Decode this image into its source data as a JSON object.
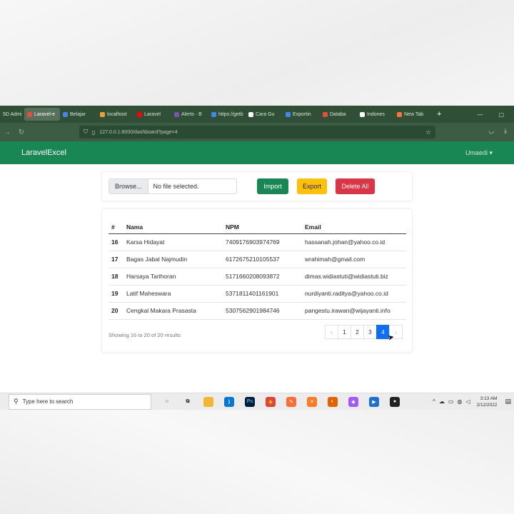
{
  "browser": {
    "tabs": [
      {
        "label": "5D Admi",
        "color": "#3a6ea5",
        "active": false
      },
      {
        "label": "Laravel-e",
        "color": "#e74c3c",
        "active": true
      },
      {
        "label": "Belajar",
        "color": "#4285f4",
        "active": false
      },
      {
        "label": "localhost",
        "color": "#f0a030",
        "active": false
      },
      {
        "label": "Laravel",
        "color": "#ff0000",
        "active": false
      },
      {
        "label": "Alerts · B",
        "color": "#7952b3",
        "active": false
      },
      {
        "label": "https://getb",
        "color": "#4285f4",
        "active": false
      },
      {
        "label": "Cara Gu",
        "color": "#ffffff",
        "active": false
      },
      {
        "label": "Exportin",
        "color": "#4285f4",
        "active": false
      },
      {
        "label": "Databa",
        "color": "#e74c3c",
        "active": false
      },
      {
        "label": "Indones",
        "color": "#ffffff",
        "active": false
      },
      {
        "label": "New Tab",
        "color": "#ff7139",
        "active": false
      }
    ],
    "url": "127.0.0.1:8000/dashboard?page=4"
  },
  "app": {
    "brand": "LaravelExcel",
    "user": "Umaedi"
  },
  "upload": {
    "browse_label": "Browse...",
    "file_status": "No file selected.",
    "import_label": "Import",
    "export_label": "Export",
    "delete_label": "Delete All"
  },
  "table": {
    "headers": {
      "num": "#",
      "nama": "Nama",
      "npm": "NPM",
      "email": "Email"
    },
    "rows": [
      {
        "num": "16",
        "nama": "Karsa Hidayat",
        "npm": "7409176903974769",
        "email": "hassanah.johan@yahoo.co.id"
      },
      {
        "num": "17",
        "nama": "Bagas Jabal Najmudin",
        "npm": "6172675210105537",
        "email": "wrahimah@gmail.com"
      },
      {
        "num": "18",
        "nama": "Harsaya Tarihoran",
        "npm": "5171660208093872",
        "email": "dimas.widiastuti@widiastuti.biz"
      },
      {
        "num": "19",
        "nama": "Latif Maheswara",
        "npm": "5371811401161901",
        "email": "nurdiyanti.raditya@yahoo.co.id"
      },
      {
        "num": "20",
        "nama": "Cengkal Makara Prasasta",
        "npm": "5307562901984746",
        "email": "pangestu.irawan@wijayanti.info"
      }
    ],
    "summary": "Showing 16 to 20 of 20 results"
  },
  "pagination": {
    "prev": "‹",
    "pages": [
      "1",
      "2",
      "3",
      "4"
    ],
    "current": "4",
    "next": "›"
  },
  "taskbar": {
    "search_placeholder": "Type here to search",
    "time": "3:13 AM",
    "date": "2/12/2022",
    "apps": [
      {
        "name": "cortana-icon",
        "color": "#ececec",
        "glyph": "○",
        "text": "#222"
      },
      {
        "name": "task-view-icon",
        "color": "#ececec",
        "glyph": "⧉",
        "text": "#222"
      },
      {
        "name": "file-explorer-icon",
        "color": "#f2b632",
        "glyph": "",
        "text": "#fff"
      },
      {
        "name": "vscode-icon",
        "color": "#0078d4",
        "glyph": "⟩",
        "text": "#fff"
      },
      {
        "name": "photoshop-icon",
        "color": "#001e36",
        "glyph": "Ps",
        "text": "#31a8ff"
      },
      {
        "name": "chrome-icon",
        "color": "#db4437",
        "glyph": "◉",
        "text": "#f4c20d"
      },
      {
        "name": "postman-icon",
        "color": "#ff6c37",
        "glyph": "✎",
        "text": "#fff"
      },
      {
        "name": "xampp-icon",
        "color": "#fb7a24",
        "glyph": "✕",
        "text": "#fff"
      },
      {
        "name": "firefox-icon",
        "color": "#e66000",
        "glyph": "◐",
        "text": "#fff"
      },
      {
        "name": "figma-icon",
        "color": "#a259ff",
        "glyph": "◆",
        "text": "#fff"
      },
      {
        "name": "media-icon",
        "color": "#1c6fd1",
        "glyph": "▶",
        "text": "#fff"
      },
      {
        "name": "github-icon",
        "color": "#222222",
        "glyph": "●",
        "text": "#fff"
      }
    ]
  }
}
